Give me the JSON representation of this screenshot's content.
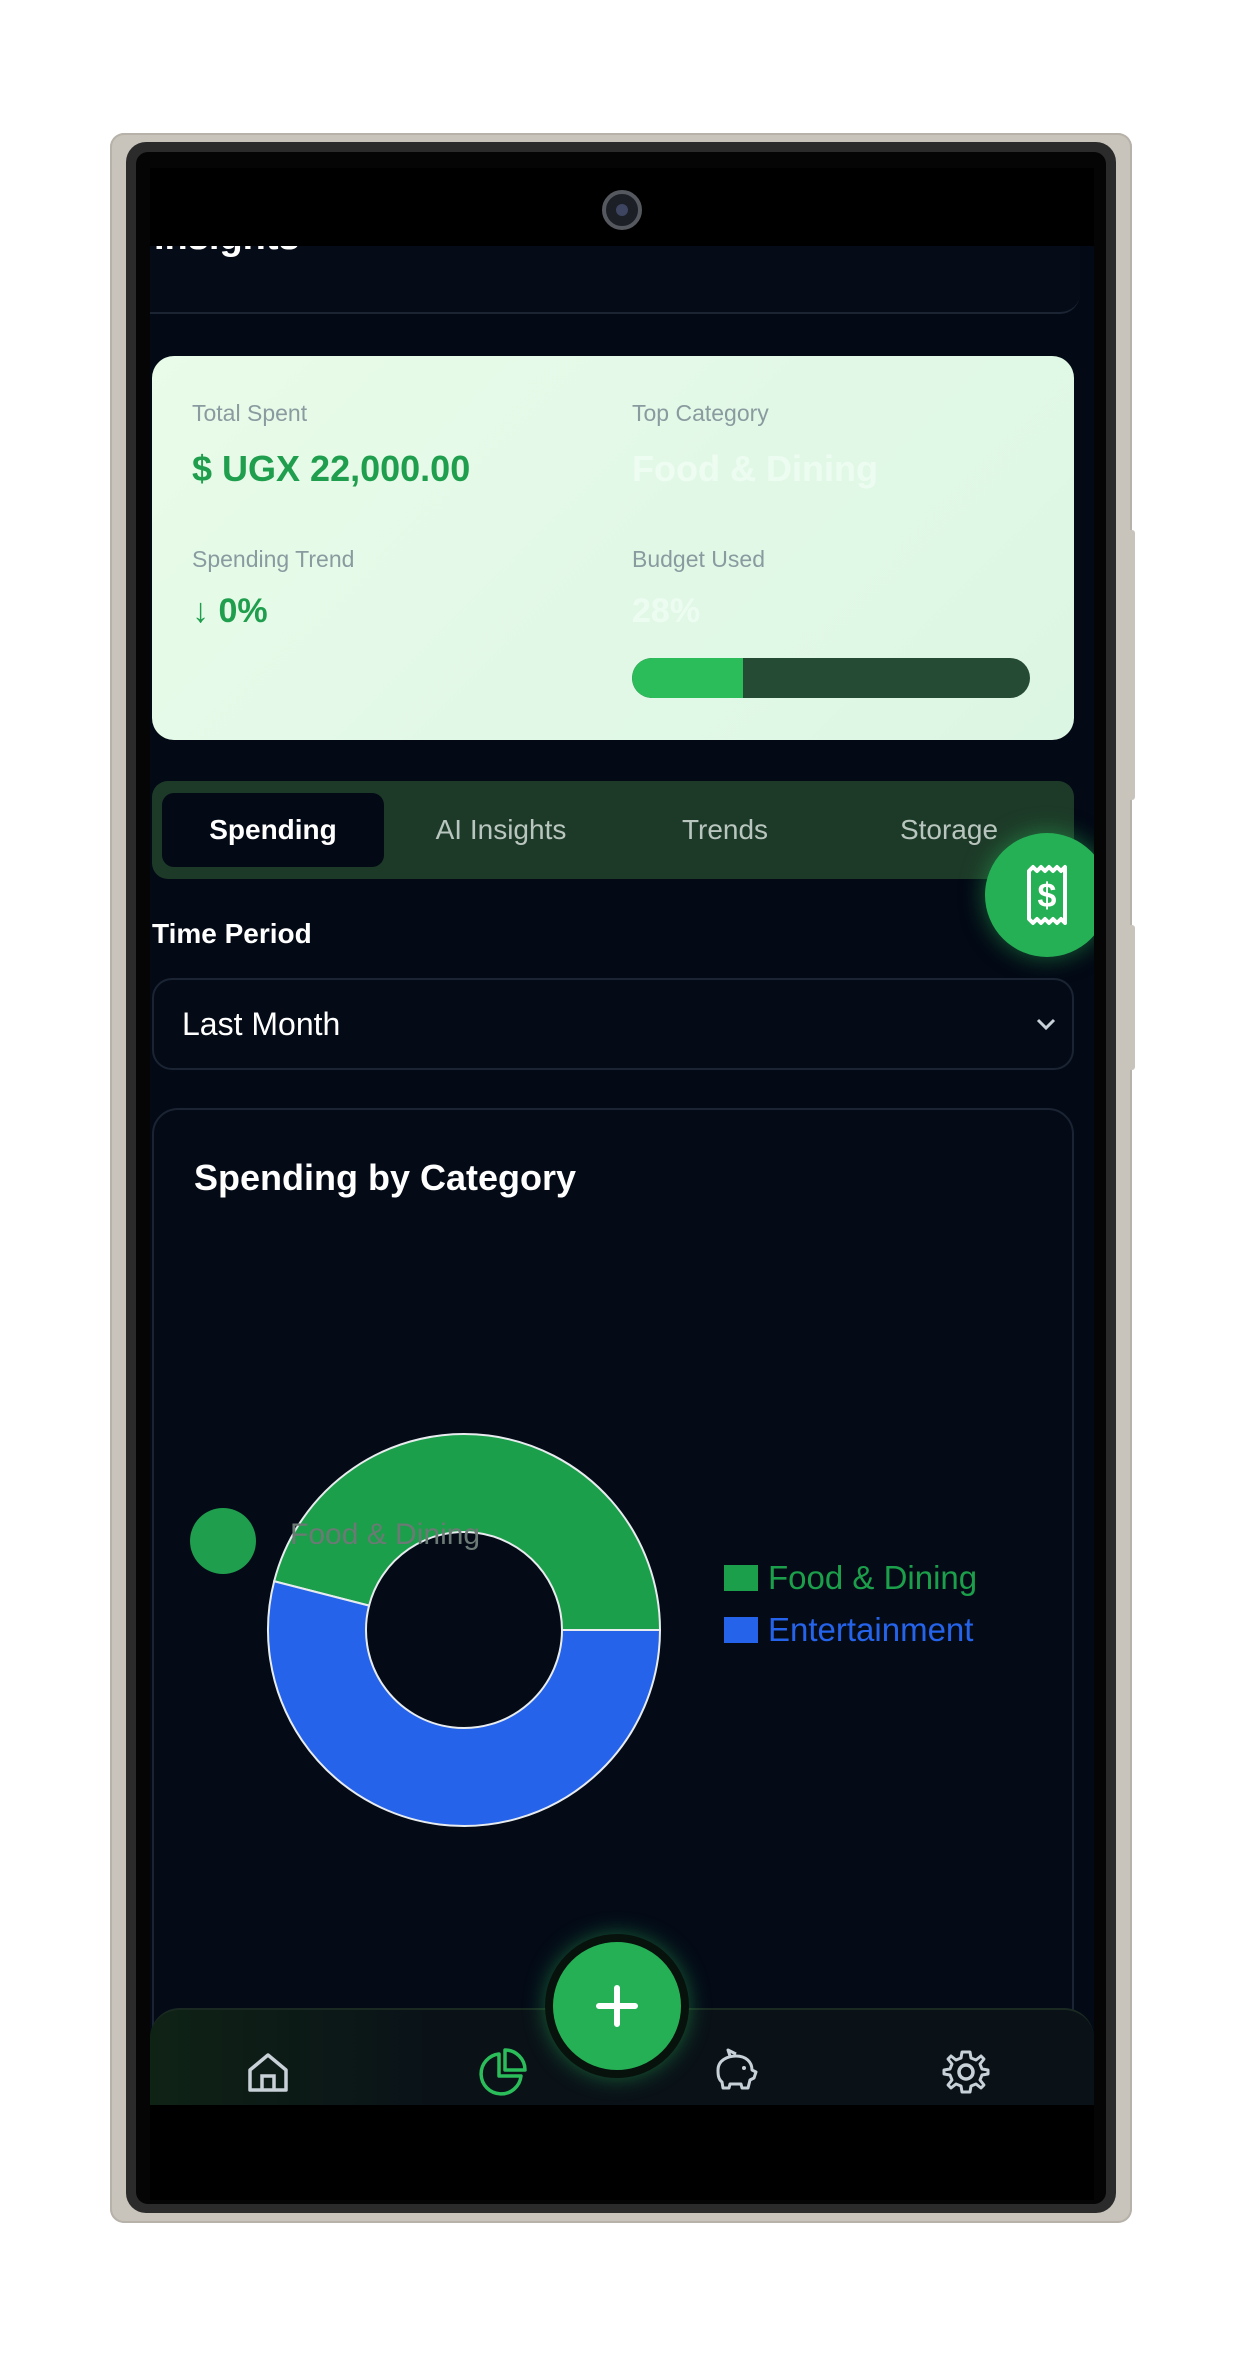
{
  "page": {
    "title": "Insights"
  },
  "summary": {
    "total_spent_label": "Total Spent",
    "total_spent_value": "UGX 22,000.00",
    "currency_symbol": "$",
    "top_category_label": "Top Category",
    "top_category_value": "Food & Dining",
    "trend_label": "Spending Trend",
    "trend_value": "0%",
    "trend_arrow": "↓",
    "budget_label": "Budget Used",
    "budget_value": "28%",
    "budget_fraction": 0.28
  },
  "tabs": [
    {
      "label": "Spending",
      "active": true
    },
    {
      "label": "AI Insights",
      "active": false
    },
    {
      "label": "Trends",
      "active": false
    },
    {
      "label": "Storage",
      "active": false
    }
  ],
  "period": {
    "label": "Time Period",
    "value": "Last Month"
  },
  "chart": {
    "title": "Spending by Category"
  },
  "chart_data": {
    "type": "pie",
    "title": "Spending by Category",
    "series": [
      {
        "name": "Food & Dining",
        "value": 0.46,
        "color": "#1b9f4a"
      },
      {
        "name": "Entertainment",
        "value": 0.54,
        "color": "#2563eb"
      }
    ]
  },
  "peek_list": {
    "first_item": "Food & Dining"
  },
  "nav": {
    "items": [
      "home-icon",
      "pie-chart-icon",
      "piggy-bank-icon",
      "settings-icon"
    ],
    "active_index": 1,
    "accent": "#2bbd5a"
  },
  "colors": {
    "accent": "#26b056",
    "background": "#030915",
    "card": "#e9fbe9"
  }
}
